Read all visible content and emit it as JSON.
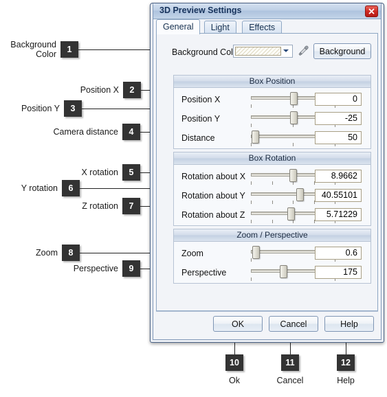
{
  "dialog": {
    "title": "3D Preview Settings",
    "close_icon": "close-icon",
    "tabs": [
      {
        "label": "General",
        "active": true
      },
      {
        "label": "Light",
        "active": false
      },
      {
        "label": "Effects",
        "active": false
      }
    ],
    "background_row": {
      "label": "Background Color",
      "swatch_pattern": "diagonal-hatch",
      "dropdown_icon": "chevron-down-icon",
      "eyedropper_icon": "eyedropper-icon",
      "button_label": "Background"
    },
    "groups": [
      {
        "title": "Box Position",
        "rows": [
          {
            "label": "Position X",
            "value": "0",
            "thumb_pct": 50,
            "ticks": 3
          },
          {
            "label": "Position Y",
            "value": "-25",
            "thumb_pct": 50,
            "ticks": 3
          },
          {
            "label": "Distance",
            "value": "50",
            "thumb_pct": 4,
            "ticks": 3
          }
        ]
      },
      {
        "title": "Box Rotation",
        "rows": [
          {
            "label": "Rotation about X",
            "value": "8.9662",
            "thumb_pct": 49,
            "ticks": 5
          },
          {
            "label": "Rotation about Y",
            "value": "40.55101",
            "thumb_pct": 57,
            "ticks": 5
          },
          {
            "label": "Rotation about Z",
            "value": "5.71229",
            "thumb_pct": 47,
            "ticks": 5
          }
        ]
      },
      {
        "title": "Zoom / Perspective",
        "rows": [
          {
            "label": "Zoom",
            "value": "0.6",
            "thumb_pct": 5,
            "ticks": 2
          },
          {
            "label": "Perspective",
            "value": "175",
            "thumb_pct": 38,
            "ticks": 2
          }
        ]
      }
    ],
    "buttons": [
      {
        "label": "OK"
      },
      {
        "label": "Cancel"
      },
      {
        "label": "Help"
      }
    ]
  },
  "callouts": {
    "left": [
      {
        "number": "1",
        "label": "Background\nColor"
      },
      {
        "number": "2",
        "label": "Position X"
      },
      {
        "number": "3",
        "label": "Position Y"
      },
      {
        "number": "4",
        "label": "Camera distance"
      },
      {
        "number": "5",
        "label": "X rotation"
      },
      {
        "number": "6",
        "label": "Y rotation"
      },
      {
        "number": "7",
        "label": "Z rotation"
      },
      {
        "number": "8",
        "label": "Zoom"
      },
      {
        "number": "9",
        "label": "Perspective"
      }
    ],
    "bottom": [
      {
        "number": "10",
        "label": "Ok"
      },
      {
        "number": "11",
        "label": "Cancel"
      },
      {
        "number": "12",
        "label": "Help"
      }
    ]
  },
  "colors": {
    "badge_bg": "#333333",
    "title_text": "#17335c",
    "close_btn": "#cf2a22",
    "dialog_border": "#4a6285"
  }
}
